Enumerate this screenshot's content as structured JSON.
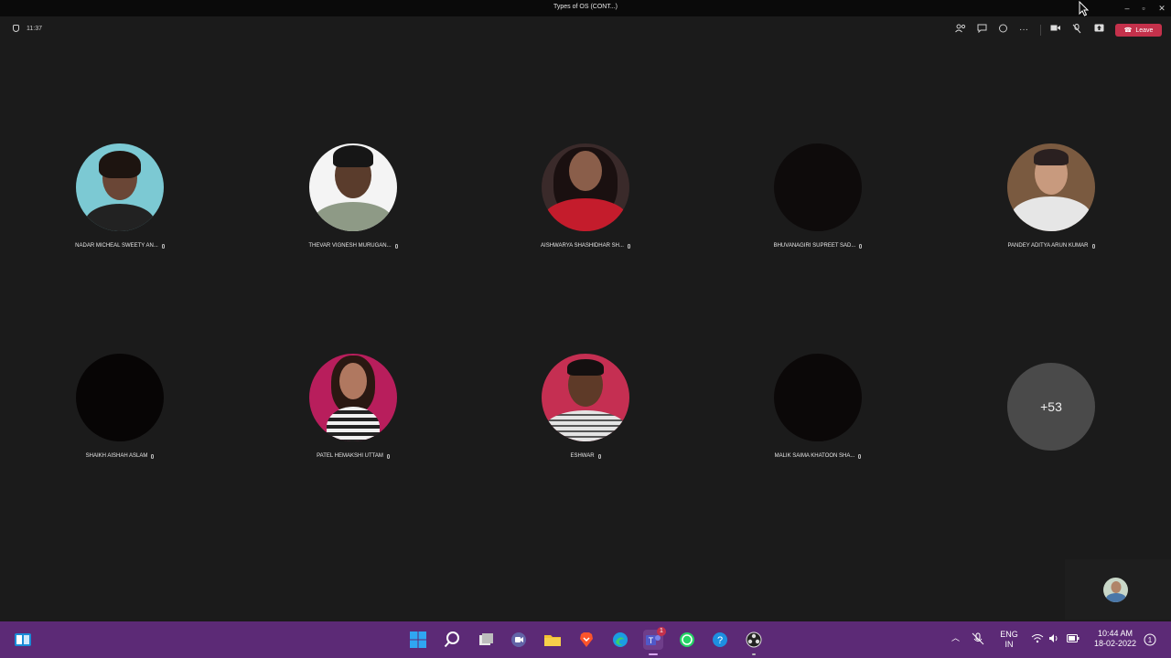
{
  "window": {
    "title": "Types of OS (CONT...)"
  },
  "meeting": {
    "timer": "11:37",
    "leave_label": "Leave"
  },
  "participants": [
    {
      "name": "NADAR MICHEAL SWEETY AN..."
    },
    {
      "name": "THEVAR VIGNESH MURUGAN..."
    },
    {
      "name": "AISHWARYA SHASHIDHAR SH..."
    },
    {
      "name": "BHUVANAGIRI SUPREET SAD..."
    },
    {
      "name": "PANDEY ADITYA ARUN KUMAR"
    },
    {
      "name": "SHAIKH AISHAH ASLAM"
    },
    {
      "name": "PATEL HEMAKSHI UTTAM"
    },
    {
      "name": "ESHWAR"
    },
    {
      "name": "MALIK SAIMA KHATOON SHA..."
    }
  ],
  "overflow": {
    "label": "+53"
  },
  "taskbar": {
    "language_line1": "ENG",
    "language_line2": "IN",
    "time": "10:44 AM",
    "date": "18-02-2022",
    "teams_badge": "1"
  },
  "colors": {
    "leave": "#c4314b",
    "taskbar": "#5c2a76",
    "stage": "#1b1b1b"
  }
}
